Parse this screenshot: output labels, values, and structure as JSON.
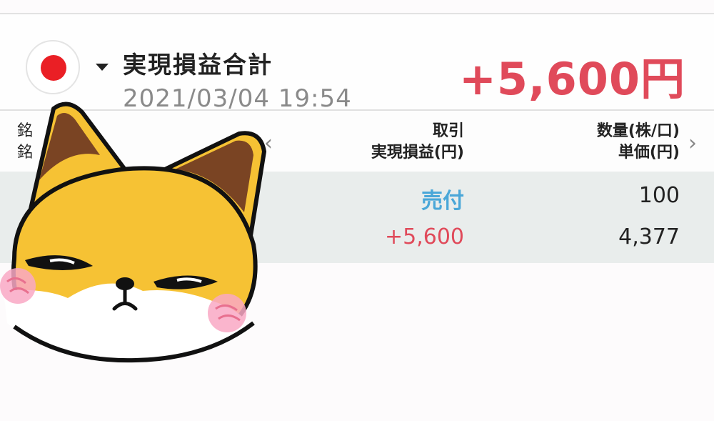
{
  "header": {
    "title": "実現損益合計",
    "timestamp": "2021/03/04  19:54",
    "total": "+5,600円",
    "flag_icon": "japan-flag-icon",
    "dropdown_icon": "caret-down-icon"
  },
  "columns": {
    "left_line1": "銘",
    "left_line2": "銘",
    "trade_line1": "取引",
    "trade_line2": "実現損益(円)",
    "qty_line1": "数量(株/口)",
    "qty_line2": "単価(円)",
    "prev_icon": "chevron-left-icon",
    "next_icon": "chevron-right-icon"
  },
  "row": {
    "side": "売付",
    "realized_pl": "+5,600",
    "quantity": "100",
    "unit_price": "4,377"
  },
  "colors": {
    "profit": "#e04a5a",
    "sell": "#4aa7d8",
    "row_bg": "#e9edec"
  }
}
